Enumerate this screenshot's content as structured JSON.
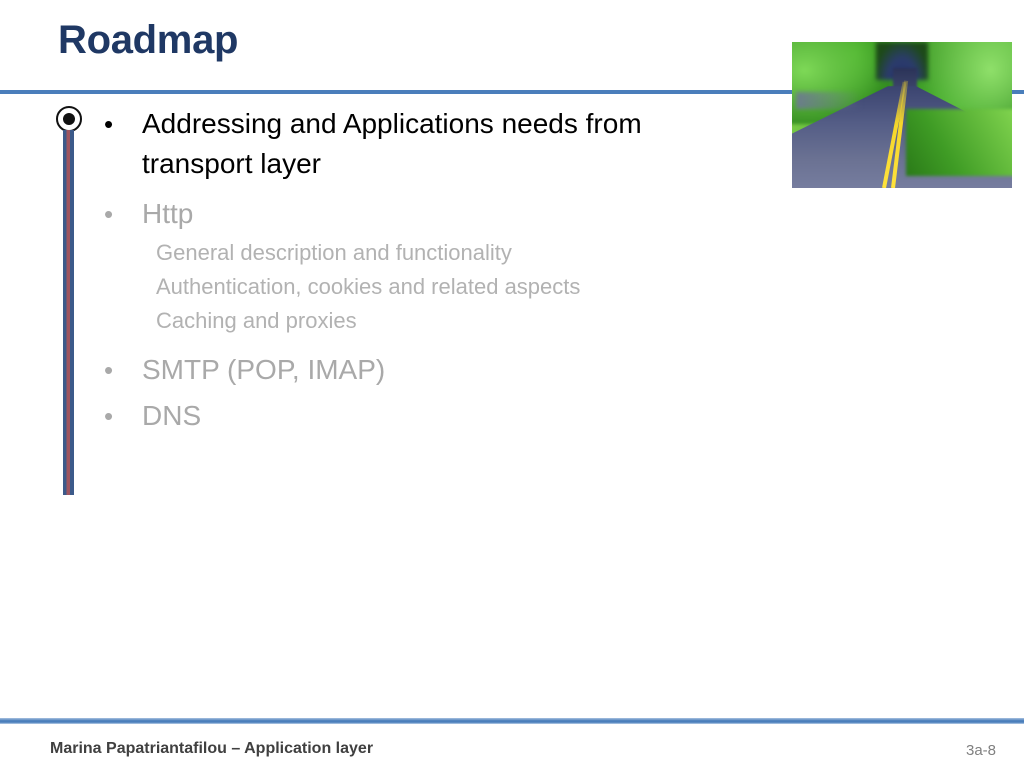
{
  "slide": {
    "title": "Roadmap",
    "accent_color": "#4A7EBB",
    "title_color": "#1F3864",
    "muted_color": "#A9A9A9"
  },
  "content": {
    "bullets": [
      {
        "label": "Addressing and Applications needs from transport layer",
        "marker": "•",
        "emphasis": "dark"
      },
      {
        "label": "Http",
        "marker": "•",
        "emphasis": "muted",
        "sub_items": [
          "General description and functionality",
          "Authentication, cookies and related aspects",
          "Caching and proxies"
        ]
      },
      {
        "label": "SMTP (POP, IMAP)",
        "marker": "•",
        "emphasis": "muted"
      },
      {
        "label": "DNS",
        "marker": "•",
        "emphasis": "muted"
      }
    ]
  },
  "decor": {
    "photo_caption": "road-through-forest-photo",
    "bar_colors": {
      "outer": "#3C5A8A",
      "inner": "#9E5560"
    }
  },
  "footer": {
    "author_line": "Marina Papatriantafilou –  Application layer",
    "page_number": "3a-8"
  }
}
